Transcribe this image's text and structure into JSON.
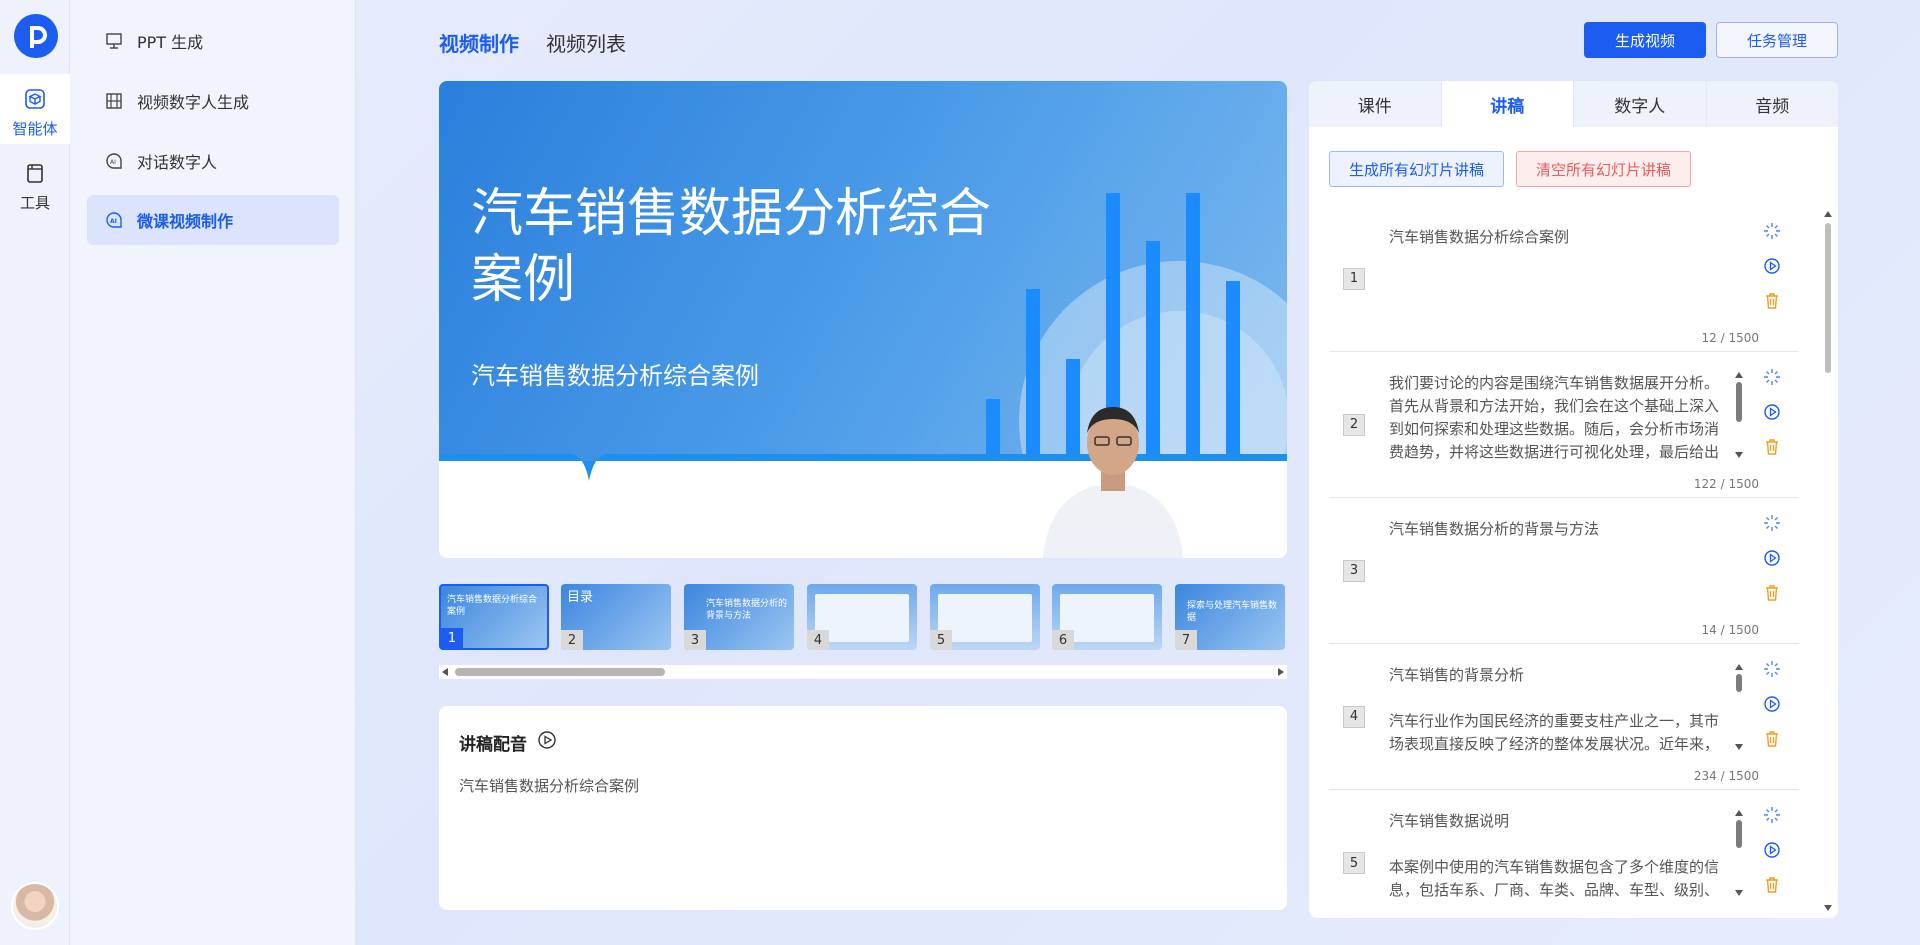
{
  "rail": {
    "items": [
      {
        "label": "智能体",
        "icon": "cube-icon",
        "active": true
      },
      {
        "label": "工具",
        "icon": "book-icon",
        "active": false
      }
    ]
  },
  "menu": {
    "items": [
      {
        "label": "PPT 生成",
        "icon": "presentation-icon"
      },
      {
        "label": "视频数字人生成",
        "icon": "film-icon"
      },
      {
        "label": "对话数字人",
        "icon": "ai-head-icon"
      },
      {
        "label": "微课视频制作",
        "icon": "ai-head-icon",
        "active": true
      }
    ]
  },
  "header": {
    "tabs": [
      {
        "label": "视频制作",
        "active": true
      },
      {
        "label": "视频列表",
        "active": false
      }
    ],
    "generate_button": "生成视频",
    "tasks_button": "任务管理"
  },
  "preview": {
    "title": "汽车销售数据分析综合案例",
    "subtitle": "汽车销售数据分析综合案例"
  },
  "thumbnails": [
    {
      "num": "1",
      "text": "汽车销售数据分析综合案例"
    },
    {
      "num": "2",
      "text": "目录"
    },
    {
      "num": "3",
      "text": "汽车销售数据分析的背景与方法"
    },
    {
      "num": "4",
      "text": ""
    },
    {
      "num": "5",
      "text": ""
    },
    {
      "num": "6",
      "text": ""
    },
    {
      "num": "7",
      "text": "探索与处理汽车销售数据"
    }
  ],
  "narration": {
    "title": "讲稿配音",
    "text": "汽车销售数据分析综合案例"
  },
  "right_panel": {
    "tabs": [
      {
        "label": "课件",
        "active": false
      },
      {
        "label": "讲稿",
        "active": true
      },
      {
        "label": "数字人",
        "active": false
      },
      {
        "label": "音频",
        "active": false
      }
    ],
    "generate_all": "生成所有幻灯片讲稿",
    "clear_all": "清空所有幻灯片讲稿",
    "slides": [
      {
        "num": "1",
        "text": "汽车销售数据分析综合案例",
        "count": "12 / 1500"
      },
      {
        "num": "2",
        "text": "我们要讨论的内容是围绕汽车销售数据展开分析。首先从背景和方法开始，我们会在这个基础上深入到如何探索和处理这些数据。随后，会分析市场消费趋势，并将这些数据进行可视化处理，最后给出",
        "count": "122 / 1500"
      },
      {
        "num": "3",
        "text": "汽车销售数据分析的背景与方法",
        "count": "14 / 1500"
      },
      {
        "num": "4",
        "text": "汽车销售的背景分析\n\n汽车行业作为国民经济的重要支柱产业之一，其市场表现直接反映了经济的整体发展状况。近年来，",
        "count": "234 / 1500"
      },
      {
        "num": "5",
        "text": "汽车销售数据说明\n\n本案例中使用的汽车销售数据包含了多个维度的信息，包括车系、厂商、车类、品牌、车型、级别、",
        "count": ""
      }
    ]
  }
}
